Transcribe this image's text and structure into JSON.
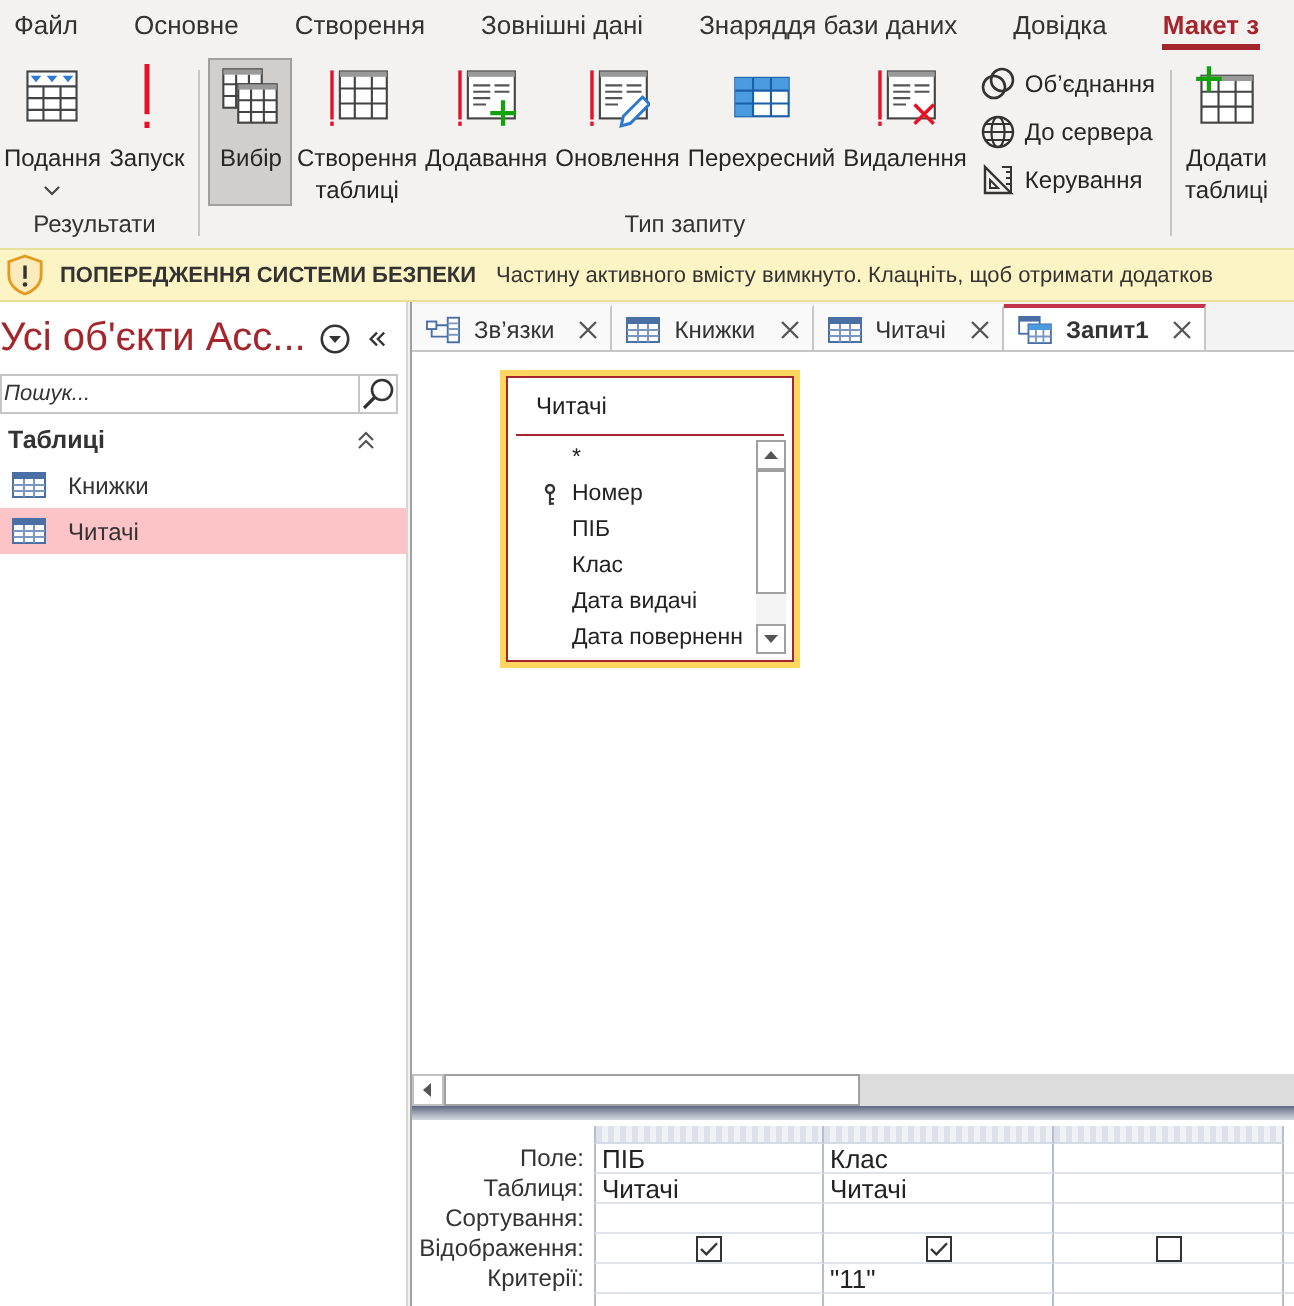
{
  "menu_tabs": [
    {
      "label": "Файл",
      "selected": false
    },
    {
      "label": "Основне",
      "selected": false
    },
    {
      "label": "Створення",
      "selected": false
    },
    {
      "label": "Зовнішні дані",
      "selected": false
    },
    {
      "label": "Знаряддя бази даних",
      "selected": false
    },
    {
      "label": "Довідка",
      "selected": false
    },
    {
      "label": "Макет з",
      "selected": true
    }
  ],
  "ribbon": {
    "groups": [
      {
        "label": "Результати",
        "buttons": [
          {
            "kind": "large",
            "label": "Подання",
            "dropdown": true,
            "selected": false
          },
          {
            "kind": "large",
            "label": "Запуск",
            "dropdown": false,
            "selected": false
          }
        ]
      },
      {
        "label": "Тип запиту",
        "buttons": [
          {
            "kind": "large",
            "label": "Вибір",
            "dropdown": false,
            "selected": true
          },
          {
            "kind": "large",
            "label": "Створення таблиці",
            "dropdown": false,
            "selected": false
          },
          {
            "kind": "large",
            "label": "Додавання",
            "dropdown": false,
            "selected": false
          },
          {
            "kind": "large",
            "label": "Оновлення",
            "dropdown": false,
            "selected": false
          },
          {
            "kind": "large",
            "label": "Перехресний",
            "dropdown": false,
            "selected": false
          },
          {
            "kind": "large",
            "label": "Видалення",
            "dropdown": false,
            "selected": false
          },
          {
            "kind": "small",
            "label": "Об’єднання",
            "dropdown": false,
            "selected": false
          },
          {
            "kind": "small",
            "label": "До сервера",
            "dropdown": false,
            "selected": false
          },
          {
            "kind": "small",
            "label": "Керування",
            "dropdown": false,
            "selected": false
          }
        ]
      },
      {
        "buttons": [
          {
            "kind": "large",
            "label": "Додати таблиці",
            "dropdown": false,
            "selected": false
          }
        ]
      }
    ]
  },
  "security_bar": {
    "title": "ПОПЕРЕДЖЕННЯ СИСТЕМИ БЕЗПЕКИ",
    "message": "Частину активного вмісту вимкнуто. Клацніть, щоб отримати додатков"
  },
  "navigation_pane": {
    "title": "Усі об'єкти Асс...",
    "search": {
      "placeholder": "Пошук..."
    },
    "groups": [
      {
        "label": "Таблиці",
        "expanded": true,
        "items": [
          {
            "label": "Книжки",
            "selected": false
          },
          {
            "label": "Читачі",
            "selected": true
          }
        ]
      }
    ]
  },
  "document_tabs": [
    {
      "kind": "relationships",
      "label": "Зв’язки",
      "selected": false
    },
    {
      "kind": "table",
      "label": "Книжки",
      "selected": false
    },
    {
      "kind": "table",
      "label": "Читачі",
      "selected": false
    },
    {
      "kind": "query",
      "label": "Запит1",
      "selected": true
    }
  ],
  "query_design": {
    "tables": [
      {
        "title": "Читачі",
        "fields": [
          {
            "name": "*",
            "key": false
          },
          {
            "name": "Номер",
            "key": true
          },
          {
            "name": "ПІБ",
            "key": false
          },
          {
            "name": "Клас",
            "key": false
          },
          {
            "name": "Дата видачі",
            "key": false
          },
          {
            "name": "Дата поверненн",
            "key": false
          }
        ]
      }
    ],
    "grid": {
      "row_labels": [
        "Поле:",
        "Таблиця:",
        "Сортування:",
        "Відображення:",
        "Критерії:"
      ],
      "columns": [
        {
          "field": "ПІБ",
          "table": "Читачі",
          "show": true
        },
        {
          "field": "Клас",
          "table": "Читачі",
          "show": true,
          "criteria": "\"11\""
        },
        {
          "show": false
        }
      ]
    }
  }
}
